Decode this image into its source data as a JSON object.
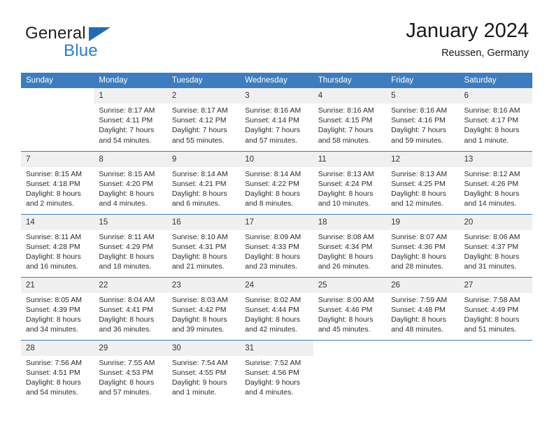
{
  "brand": {
    "name_part1": "General",
    "name_part2": "Blue",
    "triangle_color": "#1f6cb4",
    "blue_color": "#2a7dd1"
  },
  "header": {
    "title": "January 2024",
    "subtitle": "Reussen, Germany"
  },
  "theme": {
    "header_blue": "#3d7cbe",
    "daynum_band": "#f0f0f0",
    "text": "#2b2b2b"
  },
  "calendar": {
    "weekday_headers": [
      "Sunday",
      "Monday",
      "Tuesday",
      "Wednesday",
      "Thursday",
      "Friday",
      "Saturday"
    ],
    "weeks": [
      [
        {
          "day": "",
          "sunrise": "",
          "sunset": "",
          "daylight_line1": "",
          "daylight_line2": ""
        },
        {
          "day": "1",
          "sunrise": "Sunrise: 8:17 AM",
          "sunset": "Sunset: 4:11 PM",
          "daylight_line1": "Daylight: 7 hours",
          "daylight_line2": "and 54 minutes."
        },
        {
          "day": "2",
          "sunrise": "Sunrise: 8:17 AM",
          "sunset": "Sunset: 4:12 PM",
          "daylight_line1": "Daylight: 7 hours",
          "daylight_line2": "and 55 minutes."
        },
        {
          "day": "3",
          "sunrise": "Sunrise: 8:16 AM",
          "sunset": "Sunset: 4:14 PM",
          "daylight_line1": "Daylight: 7 hours",
          "daylight_line2": "and 57 minutes."
        },
        {
          "day": "4",
          "sunrise": "Sunrise: 8:16 AM",
          "sunset": "Sunset: 4:15 PM",
          "daylight_line1": "Daylight: 7 hours",
          "daylight_line2": "and 58 minutes."
        },
        {
          "day": "5",
          "sunrise": "Sunrise: 8:16 AM",
          "sunset": "Sunset: 4:16 PM",
          "daylight_line1": "Daylight: 7 hours",
          "daylight_line2": "and 59 minutes."
        },
        {
          "day": "6",
          "sunrise": "Sunrise: 8:16 AM",
          "sunset": "Sunset: 4:17 PM",
          "daylight_line1": "Daylight: 8 hours",
          "daylight_line2": "and 1 minute."
        }
      ],
      [
        {
          "day": "7",
          "sunrise": "Sunrise: 8:15 AM",
          "sunset": "Sunset: 4:18 PM",
          "daylight_line1": "Daylight: 8 hours",
          "daylight_line2": "and 2 minutes."
        },
        {
          "day": "8",
          "sunrise": "Sunrise: 8:15 AM",
          "sunset": "Sunset: 4:20 PM",
          "daylight_line1": "Daylight: 8 hours",
          "daylight_line2": "and 4 minutes."
        },
        {
          "day": "9",
          "sunrise": "Sunrise: 8:14 AM",
          "sunset": "Sunset: 4:21 PM",
          "daylight_line1": "Daylight: 8 hours",
          "daylight_line2": "and 6 minutes."
        },
        {
          "day": "10",
          "sunrise": "Sunrise: 8:14 AM",
          "sunset": "Sunset: 4:22 PM",
          "daylight_line1": "Daylight: 8 hours",
          "daylight_line2": "and 8 minutes."
        },
        {
          "day": "11",
          "sunrise": "Sunrise: 8:13 AM",
          "sunset": "Sunset: 4:24 PM",
          "daylight_line1": "Daylight: 8 hours",
          "daylight_line2": "and 10 minutes."
        },
        {
          "day": "12",
          "sunrise": "Sunrise: 8:13 AM",
          "sunset": "Sunset: 4:25 PM",
          "daylight_line1": "Daylight: 8 hours",
          "daylight_line2": "and 12 minutes."
        },
        {
          "day": "13",
          "sunrise": "Sunrise: 8:12 AM",
          "sunset": "Sunset: 4:26 PM",
          "daylight_line1": "Daylight: 8 hours",
          "daylight_line2": "and 14 minutes."
        }
      ],
      [
        {
          "day": "14",
          "sunrise": "Sunrise: 8:11 AM",
          "sunset": "Sunset: 4:28 PM",
          "daylight_line1": "Daylight: 8 hours",
          "daylight_line2": "and 16 minutes."
        },
        {
          "day": "15",
          "sunrise": "Sunrise: 8:11 AM",
          "sunset": "Sunset: 4:29 PM",
          "daylight_line1": "Daylight: 8 hours",
          "daylight_line2": "and 18 minutes."
        },
        {
          "day": "16",
          "sunrise": "Sunrise: 8:10 AM",
          "sunset": "Sunset: 4:31 PM",
          "daylight_line1": "Daylight: 8 hours",
          "daylight_line2": "and 21 minutes."
        },
        {
          "day": "17",
          "sunrise": "Sunrise: 8:09 AM",
          "sunset": "Sunset: 4:33 PM",
          "daylight_line1": "Daylight: 8 hours",
          "daylight_line2": "and 23 minutes."
        },
        {
          "day": "18",
          "sunrise": "Sunrise: 8:08 AM",
          "sunset": "Sunset: 4:34 PM",
          "daylight_line1": "Daylight: 8 hours",
          "daylight_line2": "and 26 minutes."
        },
        {
          "day": "19",
          "sunrise": "Sunrise: 8:07 AM",
          "sunset": "Sunset: 4:36 PM",
          "daylight_line1": "Daylight: 8 hours",
          "daylight_line2": "and 28 minutes."
        },
        {
          "day": "20",
          "sunrise": "Sunrise: 8:06 AM",
          "sunset": "Sunset: 4:37 PM",
          "daylight_line1": "Daylight: 8 hours",
          "daylight_line2": "and 31 minutes."
        }
      ],
      [
        {
          "day": "21",
          "sunrise": "Sunrise: 8:05 AM",
          "sunset": "Sunset: 4:39 PM",
          "daylight_line1": "Daylight: 8 hours",
          "daylight_line2": "and 34 minutes."
        },
        {
          "day": "22",
          "sunrise": "Sunrise: 8:04 AM",
          "sunset": "Sunset: 4:41 PM",
          "daylight_line1": "Daylight: 8 hours",
          "daylight_line2": "and 36 minutes."
        },
        {
          "day": "23",
          "sunrise": "Sunrise: 8:03 AM",
          "sunset": "Sunset: 4:42 PM",
          "daylight_line1": "Daylight: 8 hours",
          "daylight_line2": "and 39 minutes."
        },
        {
          "day": "24",
          "sunrise": "Sunrise: 8:02 AM",
          "sunset": "Sunset: 4:44 PM",
          "daylight_line1": "Daylight: 8 hours",
          "daylight_line2": "and 42 minutes."
        },
        {
          "day": "25",
          "sunrise": "Sunrise: 8:00 AM",
          "sunset": "Sunset: 4:46 PM",
          "daylight_line1": "Daylight: 8 hours",
          "daylight_line2": "and 45 minutes."
        },
        {
          "day": "26",
          "sunrise": "Sunrise: 7:59 AM",
          "sunset": "Sunset: 4:48 PM",
          "daylight_line1": "Daylight: 8 hours",
          "daylight_line2": "and 48 minutes."
        },
        {
          "day": "27",
          "sunrise": "Sunrise: 7:58 AM",
          "sunset": "Sunset: 4:49 PM",
          "daylight_line1": "Daylight: 8 hours",
          "daylight_line2": "and 51 minutes."
        }
      ],
      [
        {
          "day": "28",
          "sunrise": "Sunrise: 7:56 AM",
          "sunset": "Sunset: 4:51 PM",
          "daylight_line1": "Daylight: 8 hours",
          "daylight_line2": "and 54 minutes."
        },
        {
          "day": "29",
          "sunrise": "Sunrise: 7:55 AM",
          "sunset": "Sunset: 4:53 PM",
          "daylight_line1": "Daylight: 8 hours",
          "daylight_line2": "and 57 minutes."
        },
        {
          "day": "30",
          "sunrise": "Sunrise: 7:54 AM",
          "sunset": "Sunset: 4:55 PM",
          "daylight_line1": "Daylight: 9 hours",
          "daylight_line2": "and 1 minute."
        },
        {
          "day": "31",
          "sunrise": "Sunrise: 7:52 AM",
          "sunset": "Sunset: 4:56 PM",
          "daylight_line1": "Daylight: 9 hours",
          "daylight_line2": "and 4 minutes."
        },
        {
          "day": "",
          "sunrise": "",
          "sunset": "",
          "daylight_line1": "",
          "daylight_line2": ""
        },
        {
          "day": "",
          "sunrise": "",
          "sunset": "",
          "daylight_line1": "",
          "daylight_line2": ""
        },
        {
          "day": "",
          "sunrise": "",
          "sunset": "",
          "daylight_line1": "",
          "daylight_line2": ""
        }
      ]
    ]
  }
}
